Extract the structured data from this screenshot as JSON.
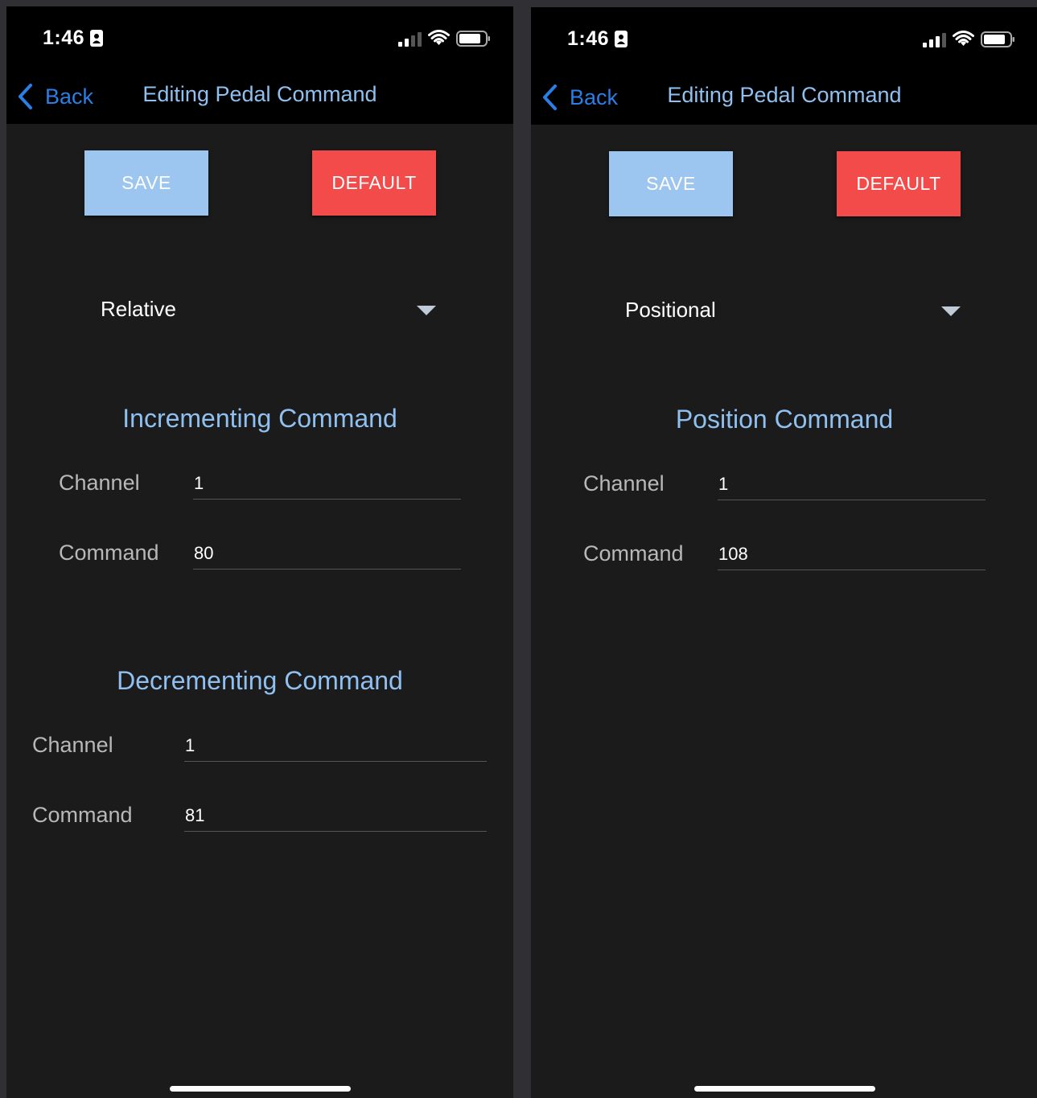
{
  "screens": [
    {
      "status": {
        "time": "1:46"
      },
      "nav": {
        "back_label": "Back",
        "title": "Editing Pedal Command"
      },
      "buttons": {
        "save_label": "SAVE",
        "default_label": "DEFAULT"
      },
      "mode": {
        "selected": "Relative"
      },
      "sections": [
        {
          "title": "Incrementing Command",
          "channel_label": "Channel",
          "channel_value": "1",
          "command_label": "Command",
          "command_value": "80"
        },
        {
          "title": "Decrementing Command",
          "channel_label": "Channel",
          "channel_value": "1",
          "command_label": "Command",
          "command_value": "81"
        }
      ]
    },
    {
      "status": {
        "time": "1:46"
      },
      "nav": {
        "back_label": "Back",
        "title": "Editing Pedal Command"
      },
      "buttons": {
        "save_label": "SAVE",
        "default_label": "DEFAULT"
      },
      "mode": {
        "selected": "Positional"
      },
      "sections": [
        {
          "title": "Position Command",
          "channel_label": "Channel",
          "channel_value": "1",
          "command_label": "Command",
          "command_value": "108"
        }
      ]
    }
  ],
  "colors": {
    "background": "#1b1b1c",
    "bar_background": "#000000",
    "accent_blue": "#2b7ee6",
    "title_blue": "#8fc0f0",
    "save_button": "#9cc6ef",
    "default_button": "#f34a4a",
    "label_gray": "#b8b8b8"
  },
  "icons": [
    "chevron-left-icon",
    "caret-down-icon",
    "person-badge-icon",
    "cellular-signal-icon",
    "wifi-icon",
    "battery-icon"
  ]
}
